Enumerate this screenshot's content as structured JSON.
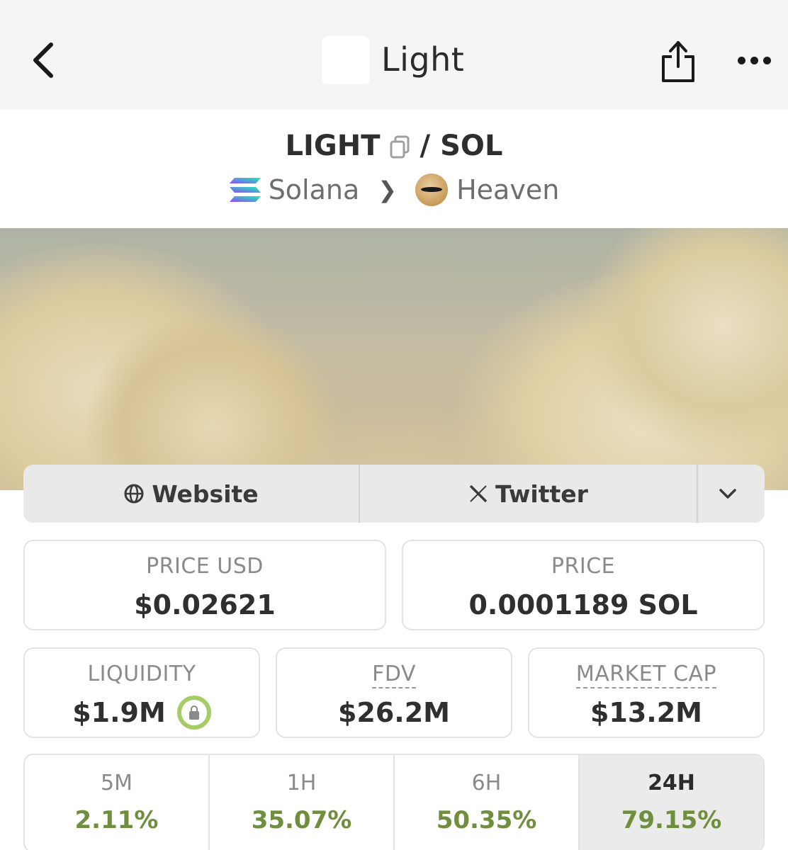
{
  "nav": {
    "title": "Light"
  },
  "pair": {
    "base": "LIGHT",
    "separator": "/",
    "quote": "SOL",
    "chain": "Solana",
    "dex": "Heaven"
  },
  "links": {
    "website": "Website",
    "twitter": "Twitter"
  },
  "stats": {
    "price_usd": {
      "label": "PRICE USD",
      "value": "$0.02621"
    },
    "price": {
      "label": "PRICE",
      "value": "0.0001189 SOL"
    },
    "liquidity": {
      "label": "LIQUIDITY",
      "value": "$1.9M"
    },
    "fdv": {
      "label": "FDV",
      "value": "$26.2M"
    },
    "market_cap": {
      "label": "MARKET CAP",
      "value": "$13.2M"
    }
  },
  "timeframes": [
    {
      "label": "5M",
      "change": "2.11%"
    },
    {
      "label": "1H",
      "change": "35.07%"
    },
    {
      "label": "6H",
      "change": "50.35%"
    },
    {
      "label": "24H",
      "change": "79.15%",
      "active": true
    }
  ],
  "colors": {
    "positive": "#6f8f3e",
    "lock_ring": "#a6cc68",
    "nav_bg": "#f5f5f5"
  },
  "icons": [
    "back-arrow-icon",
    "share-icon",
    "more-icon",
    "copy-icon",
    "solana-icon",
    "heaven-icon",
    "globe-icon",
    "x-logo-icon",
    "chevron-down-icon",
    "lock-icon"
  ]
}
